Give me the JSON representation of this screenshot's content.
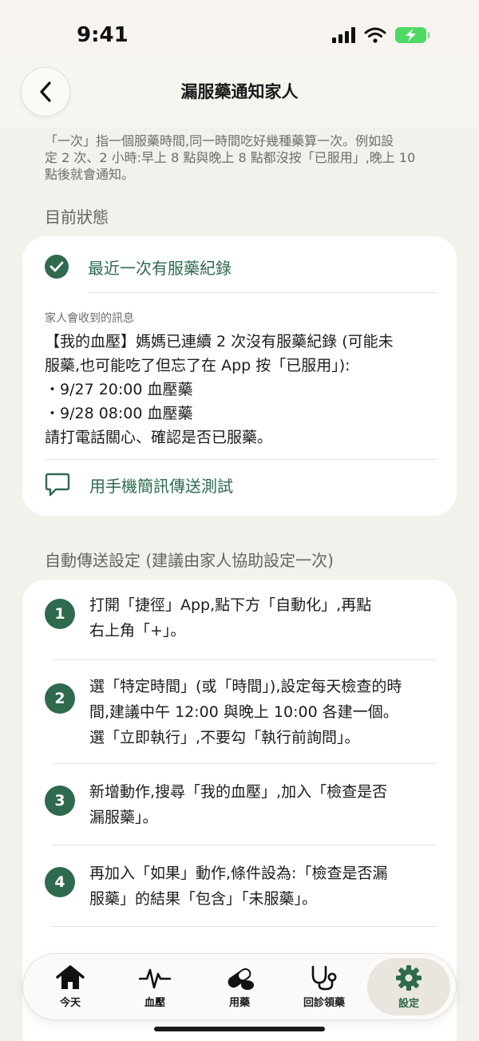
{
  "status_bar": {
    "time": "9:41"
  },
  "nav": {
    "title": "漏服藥通知家人"
  },
  "description": [
    "「一次」指一個服藥時間,同一時間吃好幾種藥算一次。例如設",
    "定 2 次、2 小時:早上 8 點與晚上 8 點都沒按「已服用」,晚上 10",
    "點後就會通知。"
  ],
  "status_section": {
    "title": "目前狀態",
    "status_text": "最近一次有服藥紀錄",
    "message_label": "家人會收到的訊息",
    "message_lines": [
      "【我的血壓】媽媽已連續 2 次沒有服藥紀錄 (可能未",
      "服藥,也可能吃了但忘了在 App 按「已服用」):",
      "・9/27 20:00 血壓藥",
      "・9/28 08:00 血壓藥",
      "請打電話關心、確認是否已服藥。"
    ],
    "test_label": "用手機簡訊傳送測試"
  },
  "auto_section": {
    "title": "自動傳送設定 (建議由家人協助設定一次)",
    "steps": [
      {
        "num": "1",
        "lines": [
          "打開「捷徑」App,點下方「自動化」,再點",
          "右上角「+」。"
        ]
      },
      {
        "num": "2",
        "lines": [
          "選「特定時間」(或「時間」),設定每天檢查的時",
          "間,建議中午 12:00 與晚上 10:00 各建一個。",
          "選「立即執行」,不要勾「執行前詢問」。"
        ]
      },
      {
        "num": "3",
        "lines": [
          "新增動作,搜尋「我的血壓」,加入「檢查是否",
          "漏服藥」。"
        ]
      },
      {
        "num": "4",
        "lines": [
          "再加入「如果」動作,條件設為:「檢查是否漏",
          "服藥」的結果「包含」「未服藥」。"
        ]
      }
    ]
  },
  "tabbar": {
    "tabs": [
      {
        "label": "今天",
        "icon": "house-icon"
      },
      {
        "label": "血壓",
        "icon": "pulse-icon"
      },
      {
        "label": "用藥",
        "icon": "pill-icon"
      },
      {
        "label": "回診領藥",
        "icon": "stethoscope-icon"
      },
      {
        "label": "設定",
        "icon": "gear-icon"
      }
    ],
    "active_index": 4
  },
  "colors": {
    "accent": "#2f6a4e",
    "background": "#f3f1ec"
  }
}
